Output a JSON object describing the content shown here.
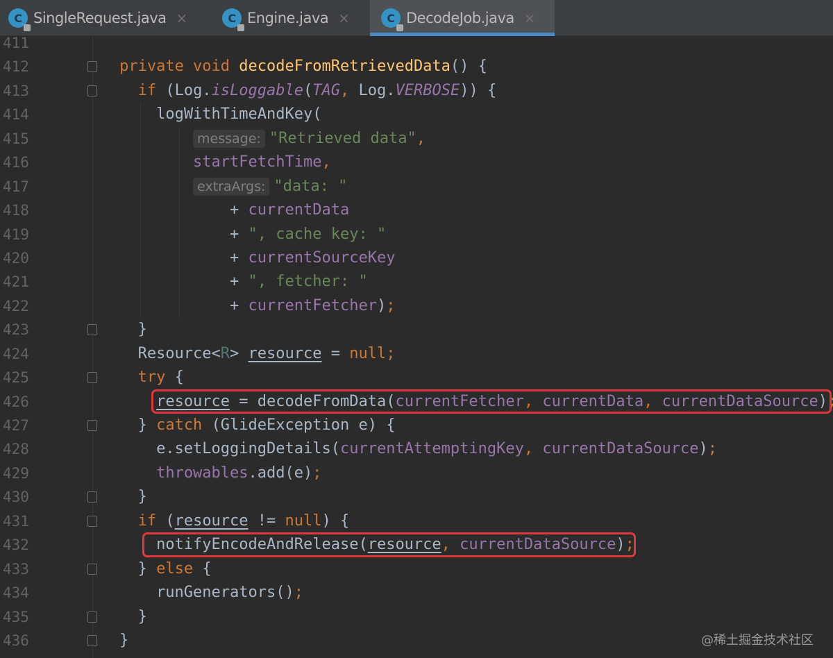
{
  "tabs": [
    {
      "label": "SingleRequest.java",
      "icon": "java-class-icon",
      "active": false
    },
    {
      "label": "Engine.java",
      "icon": "java-class-icon",
      "active": false
    },
    {
      "label": "DecodeJob.java",
      "icon": "java-class-icon",
      "active": true
    }
  ],
  "class_icon_letter": "C",
  "close_glyph": "×",
  "colors": {
    "keyword": "#cc7832",
    "method": "#ffc66d",
    "field": "#9876aa",
    "string": "#6a8759",
    "text": "#a9b7c6",
    "highlight": "#e0393d",
    "tab_accent": "#4a88c7"
  },
  "line_numbers": [
    "411",
    "412",
    "413",
    "414",
    "415",
    "416",
    "417",
    "418",
    "419",
    "420",
    "421",
    "422",
    "423",
    "424",
    "425",
    "426",
    "427",
    "428",
    "429",
    "430",
    "431",
    "432",
    "433",
    "434",
    "435",
    "436"
  ],
  "lines": [
    [],
    [
      [
        "  ",
        "pl"
      ],
      [
        "private void ",
        "kw"
      ],
      [
        "decodeFromRetrievedData",
        "fn"
      ],
      [
        "() {",
        "pl"
      ]
    ],
    [
      [
        "    ",
        "pl"
      ],
      [
        "if ",
        "kw"
      ],
      [
        "(Log.",
        "pl"
      ],
      [
        "isLoggable",
        "it"
      ],
      [
        "(",
        "pl"
      ],
      [
        "TAG",
        "it"
      ],
      [
        ", ",
        "kw"
      ],
      [
        "Log.",
        "pl"
      ],
      [
        "VERBOSE",
        "it"
      ],
      [
        ")) {",
        "pl"
      ]
    ],
    [
      [
        "      ",
        "pl"
      ],
      [
        "logWithTimeAndKey(",
        "pl"
      ]
    ],
    [
      [
        "          ",
        "pl"
      ],
      [
        "message:",
        "hint"
      ],
      [
        "\"Retrieved data\"",
        "str"
      ],
      [
        ",",
        "kw"
      ]
    ],
    [
      [
        "          ",
        "pl"
      ],
      [
        "startFetchTime",
        "fld"
      ],
      [
        ",",
        "kw"
      ]
    ],
    [
      [
        "          ",
        "pl"
      ],
      [
        "extraArgs:",
        "hint"
      ],
      [
        "\"data: \"",
        "str"
      ]
    ],
    [
      [
        "              + ",
        "pl"
      ],
      [
        "currentData",
        "fld"
      ]
    ],
    [
      [
        "              + ",
        "pl"
      ],
      [
        "\", cache key: \"",
        "str"
      ]
    ],
    [
      [
        "              + ",
        "pl"
      ],
      [
        "currentSourceKey",
        "fld"
      ]
    ],
    [
      [
        "              + ",
        "pl"
      ],
      [
        "\", fetcher: \"",
        "str"
      ]
    ],
    [
      [
        "              + ",
        "pl"
      ],
      [
        "currentFetcher",
        "fld"
      ],
      [
        ")",
        "pl"
      ],
      [
        ";",
        "kw"
      ]
    ],
    [
      [
        "    }",
        "pl"
      ]
    ],
    [
      [
        "    Resource<",
        "pl"
      ],
      [
        "R",
        "tp"
      ],
      [
        "> ",
        "pl"
      ],
      [
        "resource",
        "pl u"
      ],
      [
        " = ",
        "pl"
      ],
      [
        "null;",
        "kw"
      ]
    ],
    [
      [
        "    ",
        "pl"
      ],
      [
        "try ",
        "kw"
      ],
      [
        "{",
        "pl"
      ]
    ],
    [
      [
        "      ",
        "pl"
      ],
      [
        "resource",
        "pl u"
      ],
      [
        " = decodeFromData(",
        "pl"
      ],
      [
        "currentFetcher",
        "fld"
      ],
      [
        ", ",
        "kw"
      ],
      [
        "currentData",
        "fld"
      ],
      [
        ", ",
        "kw"
      ],
      [
        "currentDataSource",
        "fld"
      ],
      [
        ")",
        "pl"
      ],
      [
        ";",
        "kw"
      ]
    ],
    [
      [
        "    } ",
        "pl"
      ],
      [
        "catch ",
        "kw"
      ],
      [
        "(GlideException e) {",
        "pl"
      ]
    ],
    [
      [
        "      e.setLoggingDetails(",
        "pl"
      ],
      [
        "currentAttemptingKey",
        "fld"
      ],
      [
        ", ",
        "kw"
      ],
      [
        "currentDataSource",
        "fld"
      ],
      [
        ")",
        "pl"
      ],
      [
        ";",
        "kw"
      ]
    ],
    [
      [
        "      ",
        "pl"
      ],
      [
        "throwables",
        "fld"
      ],
      [
        ".add(e)",
        "pl"
      ],
      [
        ";",
        "kw"
      ]
    ],
    [
      [
        "    }",
        "pl"
      ]
    ],
    [
      [
        "    ",
        "pl"
      ],
      [
        "if ",
        "kw"
      ],
      [
        "(",
        "pl"
      ],
      [
        "resource",
        "pl u"
      ],
      [
        " != ",
        "pl"
      ],
      [
        "null",
        "kw"
      ],
      [
        ") {",
        "pl"
      ]
    ],
    [
      [
        "      notifyEncodeAndRelease(",
        "pl"
      ],
      [
        "resource",
        "pl u"
      ],
      [
        ", ",
        "kw"
      ],
      [
        "currentDataSource",
        "fld"
      ],
      [
        ")",
        "pl"
      ],
      [
        ";",
        "kw"
      ]
    ],
    [
      [
        "    } ",
        "pl"
      ],
      [
        "else ",
        "kw"
      ],
      [
        "{",
        "pl"
      ]
    ],
    [
      [
        "      runGenerators()",
        "pl"
      ],
      [
        ";",
        "kw"
      ]
    ],
    [
      [
        "    }",
        "pl"
      ]
    ],
    [
      [
        "  }",
        "pl"
      ]
    ]
  ],
  "watermark": "@稀土掘金技术社区"
}
